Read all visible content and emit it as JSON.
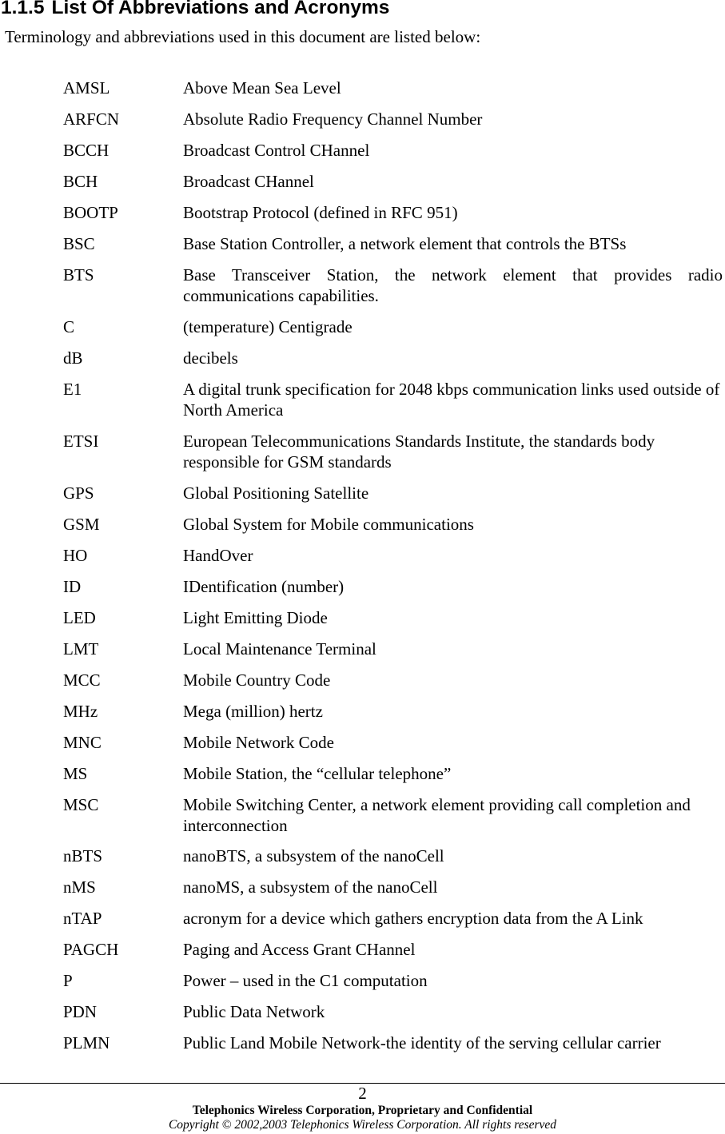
{
  "section": {
    "number": "1.1.5",
    "title": "List Of Abbreviations and Acronyms",
    "intro": "Terminology and abbreviations used in this document are listed below:"
  },
  "abbreviations": [
    {
      "abbr": "AMSL",
      "definition": "Above Mean Sea Level"
    },
    {
      "abbr": "ARFCN",
      "definition": "Absolute Radio Frequency Channel Number"
    },
    {
      "abbr": "BCCH",
      "definition": "Broadcast Control CHannel"
    },
    {
      "abbr": "BCH",
      "definition": "Broadcast CHannel"
    },
    {
      "abbr": "BOOTP",
      "definition": "Bootstrap Protocol (defined in RFC 951)"
    },
    {
      "abbr": "BSC",
      "definition": "Base Station Controller, a network element that controls the BTSs"
    },
    {
      "abbr": "BTS",
      "definition": "Base Transceiver Station, the network element that provides radio communications capabilities."
    },
    {
      "abbr": "C",
      "definition": "(temperature) Centigrade"
    },
    {
      "abbr": "dB",
      "definition": "decibels"
    },
    {
      "abbr": "E1",
      "definition": "A digital trunk specification for 2048 kbps communication links used outside of North America"
    },
    {
      "abbr": "ETSI",
      "definition": "European Telecommunications Standards Institute, the standards body responsible for GSM standards"
    },
    {
      "abbr": "GPS",
      "definition": "Global Positioning Satellite"
    },
    {
      "abbr": "GSM",
      "definition": "Global System for Mobile communications"
    },
    {
      "abbr": "HO",
      "definition": "HandOver"
    },
    {
      "abbr": "ID",
      "definition": "IDentification (number)"
    },
    {
      "abbr": "LED",
      "definition": "Light Emitting Diode"
    },
    {
      "abbr": "LMT",
      "definition": "Local Maintenance Terminal"
    },
    {
      "abbr": "MCC",
      "definition": "Mobile Country Code"
    },
    {
      "abbr": "MHz",
      "definition": "Mega (million) hertz"
    },
    {
      "abbr": "MNC",
      "definition": "Mobile Network Code"
    },
    {
      "abbr": "MS",
      "definition": "Mobile Station, the “cellular telephone”"
    },
    {
      "abbr": "MSC",
      "definition": "Mobile Switching Center, a network element providing call completion and interconnection"
    },
    {
      "abbr": "nBTS",
      "definition": "nanoBTS, a subsystem of the nanoCell"
    },
    {
      "abbr": "nMS",
      "definition": "nanoMS, a subsystem of the nanoCell"
    },
    {
      "abbr": "nTAP",
      "definition": "acronym for a device which gathers encryption data from the A Link"
    },
    {
      "abbr": "PAGCH",
      "definition": "Paging and Access Grant CHannel"
    },
    {
      "abbr": "P",
      "definition": "Power – used in the C1 computation"
    },
    {
      "abbr": "PDN",
      "definition": "Public Data Network"
    },
    {
      "abbr": "PLMN",
      "definition": "Public Land Mobile Network-the identity of the serving cellular carrier"
    }
  ],
  "footer": {
    "page_number": "2",
    "confidential": "Telephonics Wireless Corporation, Proprietary and Confidential",
    "copyright": "Copyright © 2002,2003 Telephonics Wireless Corporation.  All rights reserved"
  }
}
